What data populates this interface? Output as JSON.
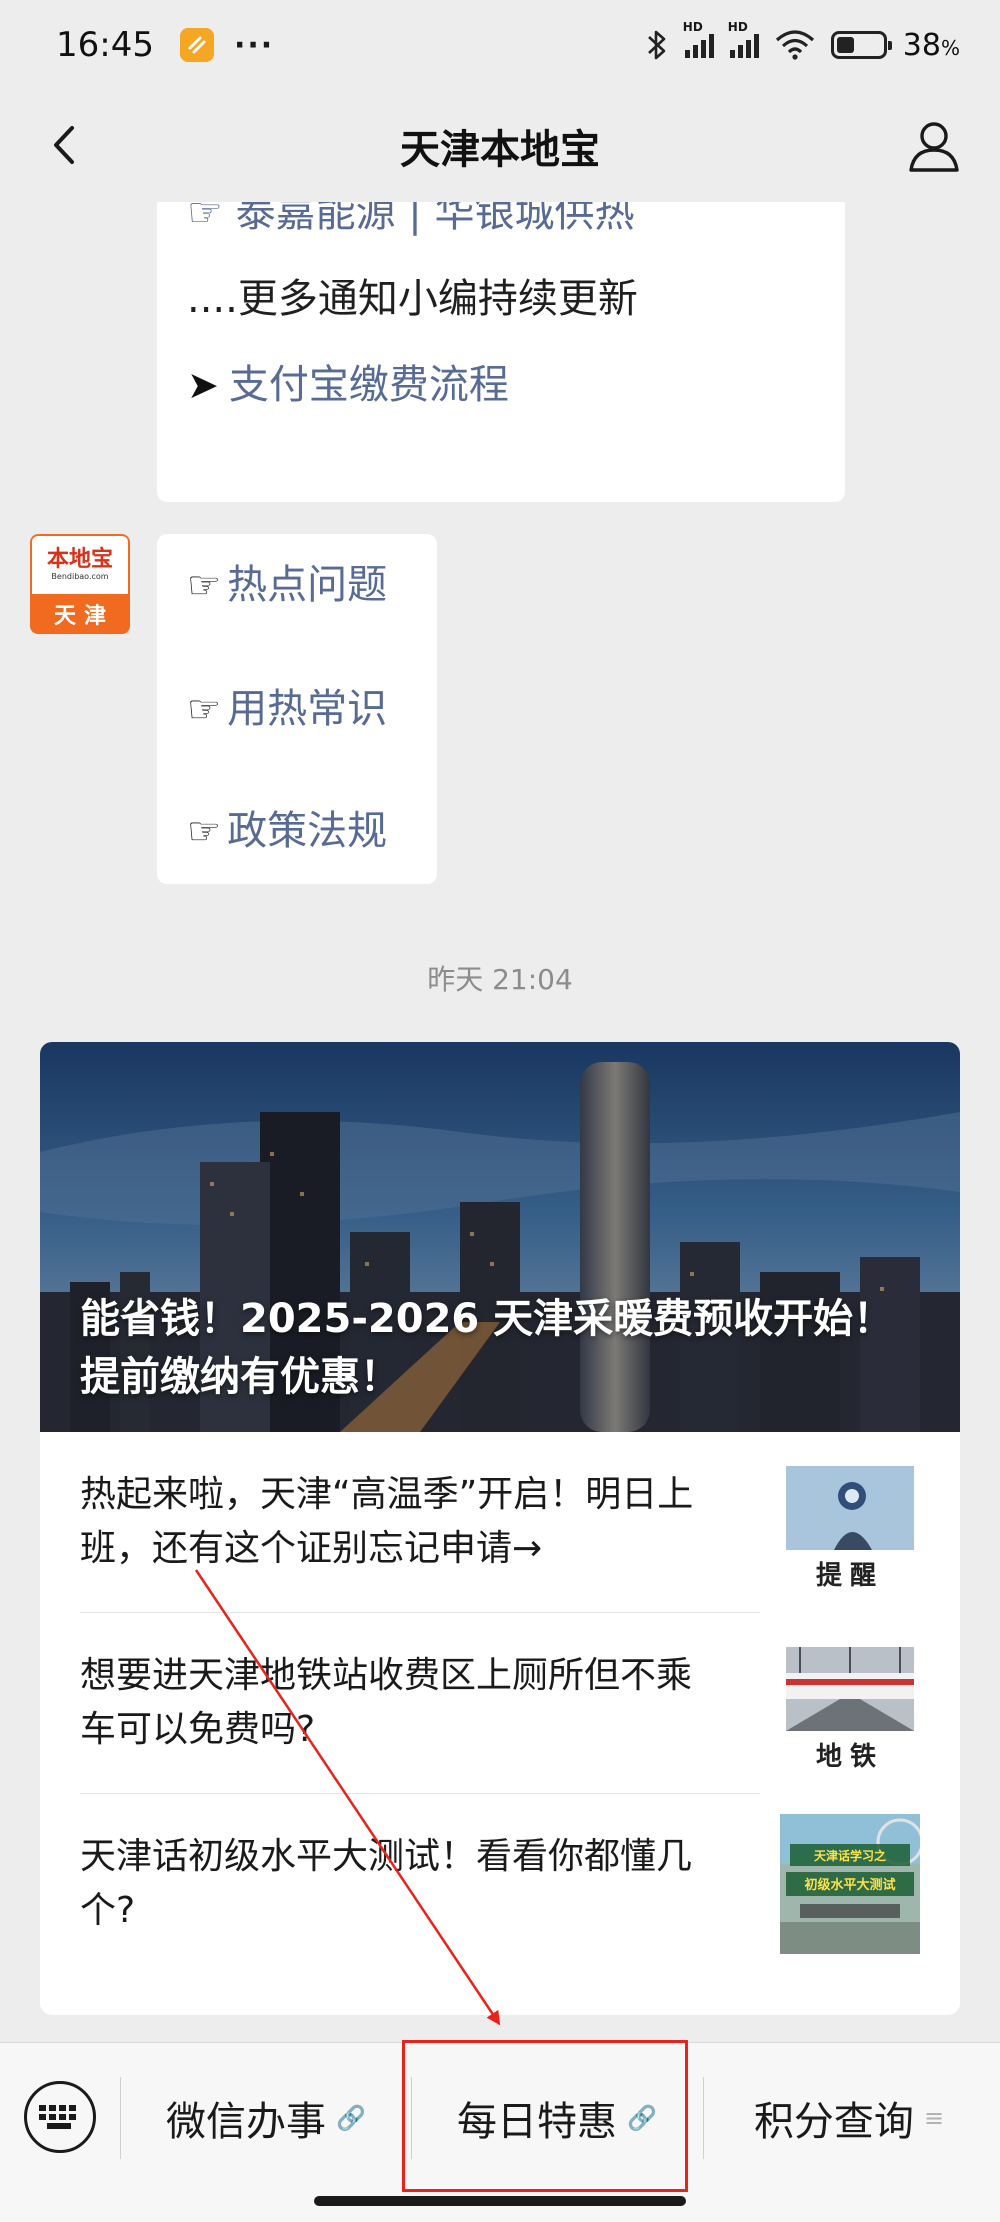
{
  "status_bar": {
    "time": "16:45",
    "more": "···",
    "signal_label": "HD",
    "battery_percent": "38",
    "battery_unit": "%",
    "battery_level": 0.38,
    "icons": [
      "app-badge-icon",
      "bluetooth-icon",
      "signal-icon",
      "wifi-icon",
      "battery-icon"
    ]
  },
  "nav": {
    "title": "天津本地宝",
    "back_icon": "chevron-left-icon",
    "profile_icon": "person-icon"
  },
  "chat": {
    "bubble1": {
      "partial_text": "☞ 泰嘉能源 | 华银城供热",
      "line1": "....更多通知小编持续更新",
      "link_arrow": "➤",
      "link_text": "支付宝缴费流程"
    },
    "avatar": {
      "brand": "本地宝",
      "brand_sub": "Bendibao.com",
      "city": "天津"
    },
    "bubble2": {
      "items": [
        {
          "hand": "☞",
          "text": "热点问题"
        },
        {
          "hand": "☞",
          "text": "用热常识"
        },
        {
          "hand": "☞",
          "text": "政策法规"
        }
      ]
    },
    "timestamp": "昨天 21:04"
  },
  "article": {
    "hero_title": "能省钱！2025-2026 天津采暖费预收开始！提前缴纳有优惠！",
    "items": [
      {
        "title": "热起来啦，天津“高温季”开启！明日上班，还有这个证别忘记申请→",
        "thumb_caption": "提醒"
      },
      {
        "title": "想要进天津地铁站收费区上厕所但不乘车可以免费吗?",
        "thumb_caption": "地铁"
      },
      {
        "title": "天津话初级水平大测试！看看你都懂几个?",
        "thumb_caption": "天津话学习之初级水平大测试"
      }
    ]
  },
  "menu": {
    "keyboard_icon": "keyboard-icon",
    "items": [
      {
        "label": "微信办事",
        "mark": "🔗"
      },
      {
        "label": "每日特惠",
        "mark": "🔗"
      },
      {
        "label": "积分查询",
        "mark": "≡"
      }
    ]
  },
  "colors": {
    "link": "#576b95",
    "annotation_red": "#e8231b",
    "brand_orange": "#f06b1f",
    "background": "#ededed"
  }
}
